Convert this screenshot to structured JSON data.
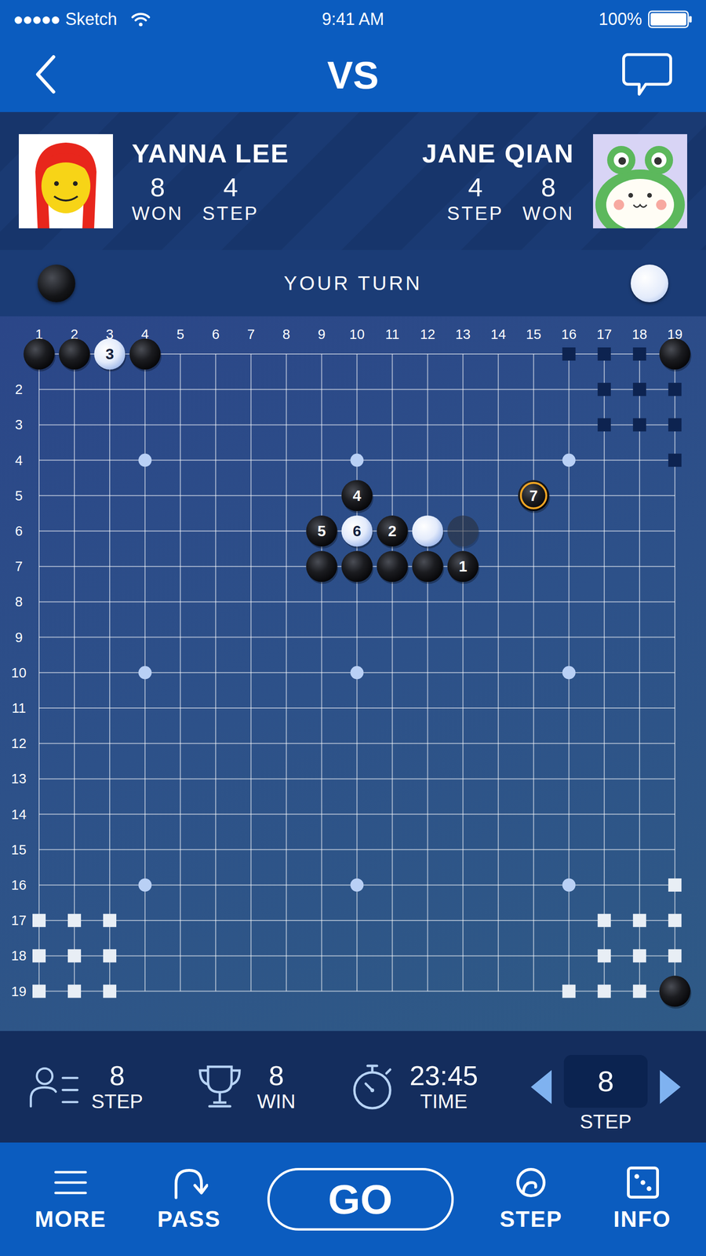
{
  "status_bar": {
    "signal": "●●●●●",
    "carrier": "Sketch",
    "time": "9:41 AM",
    "battery": "100%",
    "battery_level": 1
  },
  "nav": {
    "title": "VS"
  },
  "players": [
    {
      "name": "YANNA LEE",
      "color": "black",
      "stats": [
        {
          "value": "8",
          "label": "WON"
        },
        {
          "value": "4",
          "label": "STEP"
        }
      ]
    },
    {
      "name": "JANE QIAN",
      "color": "white",
      "stats": [
        {
          "value": "4",
          "label": "STEP"
        },
        {
          "value": "8",
          "label": "WON"
        }
      ]
    }
  ],
  "turn": {
    "label": "YOUR TURN"
  },
  "board": {
    "columns": [
      "1",
      "2",
      "3",
      "4",
      "5",
      "6",
      "7",
      "8",
      "9",
      "10",
      "11",
      "12",
      "13",
      "14",
      "15",
      "16",
      "17",
      "18",
      "19"
    ],
    "rows": [
      {
        "row": 2,
        "label": "2"
      },
      {
        "row": 3,
        "label": "3"
      },
      {
        "row": 4,
        "label": "4"
      },
      {
        "row": 5,
        "label": "5"
      },
      {
        "row": 6,
        "label": "6"
      },
      {
        "row": 7,
        "label": "7"
      },
      {
        "row": 8,
        "label": "8"
      },
      {
        "row": 9,
        "label": "9"
      },
      {
        "row": 10,
        "label": "10"
      },
      {
        "row": 11,
        "label": "11"
      },
      {
        "row": 12,
        "label": "12"
      },
      {
        "row": 13,
        "label": "13"
      },
      {
        "row": 14,
        "label": "14"
      },
      {
        "row": 15,
        "label": "15"
      },
      {
        "row": 16,
        "label": "16"
      },
      {
        "row": 17,
        "label": "17"
      },
      {
        "row": 18,
        "label": "18"
      },
      {
        "row": 19,
        "label": "19"
      }
    ],
    "star_points": [
      [
        4,
        4
      ],
      [
        10,
        4
      ],
      [
        16,
        4
      ],
      [
        4,
        10
      ],
      [
        10,
        10
      ],
      [
        16,
        10
      ],
      [
        4,
        16
      ],
      [
        10,
        16
      ],
      [
        16,
        16
      ]
    ],
    "stones": [
      {
        "col": 1,
        "row": 1,
        "color": "black",
        "number": "",
        "highlighted": false,
        "dim": false
      },
      {
        "col": 2,
        "row": 1,
        "color": "black",
        "number": "",
        "highlighted": false,
        "dim": false
      },
      {
        "col": 3,
        "row": 1,
        "color": "white",
        "number": "3",
        "highlighted": false,
        "dim": false
      },
      {
        "col": 4,
        "row": 1,
        "color": "black",
        "number": "",
        "highlighted": false,
        "dim": false
      },
      {
        "col": 19,
        "row": 1,
        "color": "black",
        "number": "",
        "highlighted": false,
        "dim": false
      },
      {
        "col": 10,
        "row": 5,
        "color": "black",
        "number": "4",
        "highlighted": false,
        "dim": false
      },
      {
        "col": 15,
        "row": 5,
        "color": "black",
        "number": "7",
        "highlighted": true,
        "dim": false
      },
      {
        "col": 9,
        "row": 6,
        "color": "black",
        "number": "5",
        "highlighted": false,
        "dim": false
      },
      {
        "col": 10,
        "row": 6,
        "color": "white",
        "number": "6",
        "highlighted": false,
        "dim": false
      },
      {
        "col": 11,
        "row": 6,
        "color": "black",
        "number": "2",
        "highlighted": false,
        "dim": false
      },
      {
        "col": 12,
        "row": 6,
        "color": "white",
        "number": "",
        "highlighted": false,
        "dim": false
      },
      {
        "col": 13,
        "row": 6,
        "color": "black",
        "number": "",
        "highlighted": false,
        "dim": true
      },
      {
        "col": 9,
        "row": 7,
        "color": "black",
        "number": "",
        "highlighted": false,
        "dim": false
      },
      {
        "col": 10,
        "row": 7,
        "color": "black",
        "number": "",
        "highlighted": false,
        "dim": false
      },
      {
        "col": 11,
        "row": 7,
        "color": "black",
        "number": "",
        "highlighted": false,
        "dim": false
      },
      {
        "col": 12,
        "row": 7,
        "color": "black",
        "number": "",
        "highlighted": false,
        "dim": false
      },
      {
        "col": 13,
        "row": 7,
        "color": "black",
        "number": "1",
        "highlighted": false,
        "dim": false
      },
      {
        "col": 19,
        "row": 19,
        "color": "black",
        "number": "",
        "highlighted": false,
        "dim": false
      }
    ],
    "marks": [
      {
        "col": 16,
        "row": 1,
        "color": "#0d2350"
      },
      {
        "col": 17,
        "row": 1,
        "color": "#0d2350"
      },
      {
        "col": 18,
        "row": 1,
        "color": "#0d2350"
      },
      {
        "col": 17,
        "row": 2,
        "color": "#0d2350"
      },
      {
        "col": 18,
        "row": 2,
        "color": "#0d2350"
      },
      {
        "col": 19,
        "row": 2,
        "color": "#0d2350"
      },
      {
        "col": 17,
        "row": 3,
        "color": "#0d2350"
      },
      {
        "col": 18,
        "row": 3,
        "color": "#0d2350"
      },
      {
        "col": 19,
        "row": 3,
        "color": "#0d2350"
      },
      {
        "col": 19,
        "row": 4,
        "color": "#0d2350"
      },
      {
        "col": 19,
        "row": 16,
        "color": "#e8eef5"
      },
      {
        "col": 17,
        "row": 17,
        "color": "#e8eef5"
      },
      {
        "col": 18,
        "row": 17,
        "color": "#e8eef5"
      },
      {
        "col": 19,
        "row": 17,
        "color": "#e8eef5"
      },
      {
        "col": 17,
        "row": 18,
        "color": "#e8eef5"
      },
      {
        "col": 18,
        "row": 18,
        "color": "#e8eef5"
      },
      {
        "col": 19,
        "row": 18,
        "color": "#e8eef5"
      },
      {
        "col": 16,
        "row": 19,
        "color": "#e8eef5"
      },
      {
        "col": 17,
        "row": 19,
        "color": "#e8eef5"
      },
      {
        "col": 18,
        "row": 19,
        "color": "#e8eef5"
      },
      {
        "col": 1,
        "row": 17,
        "color": "#e8eef5"
      },
      {
        "col": 2,
        "row": 17,
        "color": "#e8eef5"
      },
      {
        "col": 3,
        "row": 17,
        "color": "#e8eef5"
      },
      {
        "col": 1,
        "row": 18,
        "color": "#e8eef5"
      },
      {
        "col": 2,
        "row": 18,
        "color": "#e8eef5"
      },
      {
        "col": 3,
        "row": 18,
        "color": "#e8eef5"
      },
      {
        "col": 1,
        "row": 19,
        "color": "#e8eef5"
      },
      {
        "col": 2,
        "row": 19,
        "color": "#e8eef5"
      },
      {
        "col": 3,
        "row": 19,
        "color": "#e8eef5"
      }
    ]
  },
  "stats": [
    {
      "value": "8",
      "label": "STEP"
    },
    {
      "value": "8",
      "label": "WIN"
    },
    {
      "value": "23:45",
      "label": "TIME"
    }
  ],
  "step_selector": {
    "value": "8",
    "label": "STEP"
  },
  "toolbar": [
    {
      "label": "MORE",
      "kind": "icon"
    },
    {
      "label": "PASS",
      "kind": "icon"
    },
    {
      "label": "GO",
      "kind": "primary"
    },
    {
      "label": "STEP",
      "kind": "icon"
    },
    {
      "label": "INFO",
      "kind": "icon"
    }
  ]
}
